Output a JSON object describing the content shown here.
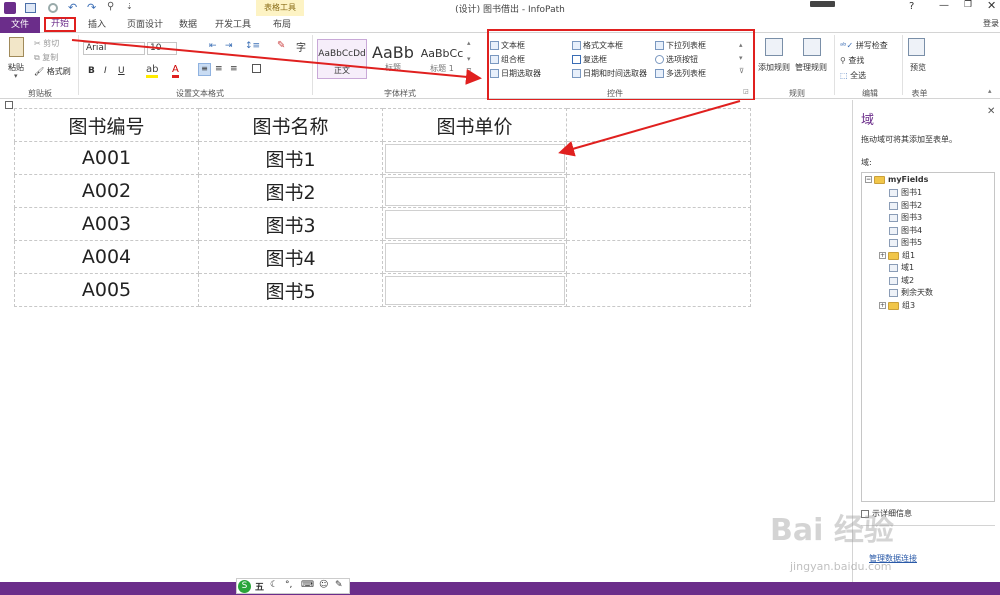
{
  "window": {
    "title": "(设计) 图书借出 - InfoPath",
    "context_tab_group": "表格工具",
    "help": "?",
    "signin": "登录"
  },
  "colors": {
    "accent": "#6b2d8a",
    "annotation": "#e0201f",
    "context_tab": "#fdf3c4"
  },
  "tabs": [
    "文件",
    "开始",
    "插入",
    "页面设计",
    "数据",
    "开发工具",
    "布局"
  ],
  "clipboard": {
    "paste": "粘贴",
    "cut": "剪切",
    "copy": "复制",
    "format_painter": "格式刷",
    "label": "剪贴板"
  },
  "font": {
    "name": "Arial",
    "size": "10",
    "label": "设置文本格式",
    "bold": "B",
    "italic": "I",
    "underline": "U",
    "font_color": "A",
    "char": "字"
  },
  "styles": {
    "items": [
      {
        "preview": "AaBbCcDd",
        "name": "正文"
      },
      {
        "preview": "AaBb",
        "name": "标题"
      },
      {
        "preview": "AaBbCc",
        "name": "标题 1"
      }
    ],
    "label": "字体样式"
  },
  "controls": {
    "items": [
      "文本框",
      "格式文本框",
      "下拉列表框",
      "组合框",
      "复选框",
      "选项按钮",
      "日期选取器",
      "日期和时间选取器",
      "多选列表框"
    ],
    "label": "控件"
  },
  "rules": {
    "add": "添加规则",
    "manage": "管理规则",
    "label": "规则"
  },
  "editing": {
    "spell": "拼写检查",
    "find": "查找",
    "select_all": "全选",
    "label": "编辑"
  },
  "form": {
    "preview": "预览",
    "label": "表单"
  },
  "table": {
    "headers": [
      "图书编号",
      "图书名称",
      "图书单价",
      ""
    ],
    "rows": [
      {
        "id": "A001",
        "name": "图书1"
      },
      {
        "id": "A002",
        "name": "图书2"
      },
      {
        "id": "A003",
        "name": "图书3"
      },
      {
        "id": "A004",
        "name": "图书4"
      },
      {
        "id": "A005",
        "name": "图书5"
      }
    ]
  },
  "taskpane": {
    "title": "域",
    "subtitle": "拖动域可将其添加至表单。",
    "fields_label": "域:",
    "tree": [
      {
        "label": "myFields",
        "type": "folder",
        "expanded": true,
        "level": 0
      },
      {
        "label": "图书1",
        "type": "field",
        "level": 1
      },
      {
        "label": "图书2",
        "type": "field",
        "level": 1
      },
      {
        "label": "图书3",
        "type": "field",
        "level": 1
      },
      {
        "label": "图书4",
        "type": "field",
        "level": 1
      },
      {
        "label": "图书5",
        "type": "field",
        "level": 1
      },
      {
        "label": "组1",
        "type": "folder",
        "expanded": false,
        "level": 1
      },
      {
        "label": "域1",
        "type": "field",
        "level": 1
      },
      {
        "label": "域2",
        "type": "field",
        "level": 1
      },
      {
        "label": "剩余天数",
        "type": "field",
        "level": 1
      },
      {
        "label": "组3",
        "type": "folder",
        "expanded": false,
        "level": 1
      }
    ],
    "show_details": "示详细信息",
    "footer_link": "管理数据连接"
  },
  "watermark": {
    "brand": "Bai 经验",
    "url": "jingyan.baidu.com"
  },
  "taskbar": {
    "ime": "五"
  }
}
